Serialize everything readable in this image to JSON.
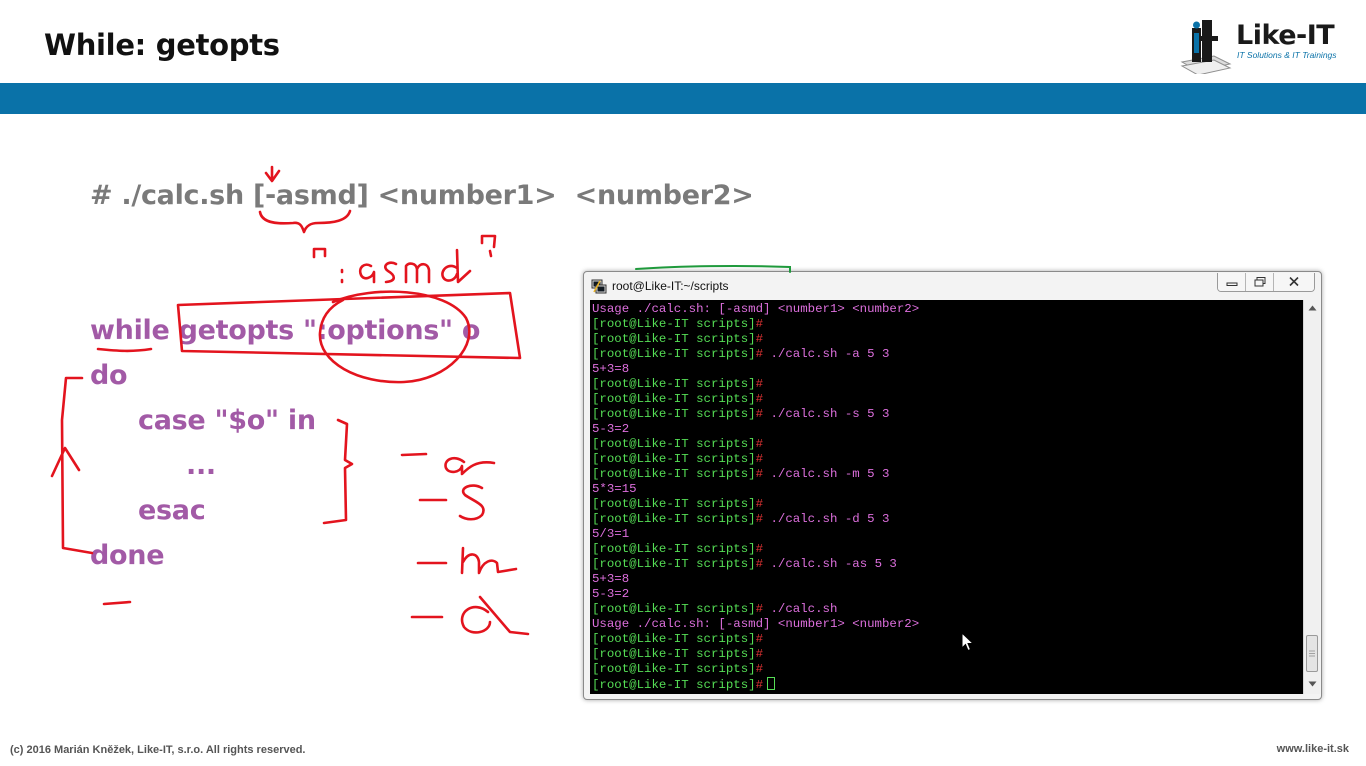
{
  "slide": {
    "title": "While: getopts",
    "logo_name": "Like-IT",
    "logo_tagline": "IT Solutions & IT Trainings",
    "syntax_line": "# ./calc.sh [-asmd] <number1>  <number2>",
    "code": [
      {
        "id": "while",
        "text": "while getopts \":options\" o"
      },
      {
        "id": "do",
        "text": "do"
      },
      {
        "id": "case",
        "text": "case \"$o\" in"
      },
      {
        "id": "dots",
        "text": "..."
      },
      {
        "id": "esac",
        "text": "esac"
      },
      {
        "id": "done",
        "text": "done"
      }
    ],
    "footer_copyright": "(c) 2016 Marián Kněžek, Like-IT, s.r.o. All rights reserved.",
    "footer_url": "www.like-it.sk"
  },
  "colors": {
    "header_band": "#0a72a8",
    "code_purple": "#a25aa6",
    "syntax_gray": "#7a7a7a",
    "ink_red": "#e3141e",
    "ink_green": "#1f9a3c",
    "term_prompt": "#55dd55",
    "term_output": "#dd6fdd",
    "term_hash": "#dd3333"
  },
  "terminal": {
    "title": "root@Like-IT:~/scripts",
    "prompt": "[root@Like-IT scripts]",
    "lines": [
      {
        "kind": "out",
        "text": "Usage ./calc.sh: [-asmd] <number1> <number2>"
      },
      {
        "kind": "prompt",
        "cmd": ""
      },
      {
        "kind": "prompt",
        "cmd": ""
      },
      {
        "kind": "prompt",
        "cmd": "./calc.sh -a 5 3"
      },
      {
        "kind": "out",
        "text": "5+3=8"
      },
      {
        "kind": "prompt",
        "cmd": ""
      },
      {
        "kind": "prompt",
        "cmd": ""
      },
      {
        "kind": "prompt",
        "cmd": "./calc.sh -s 5 3"
      },
      {
        "kind": "out",
        "text": "5-3=2"
      },
      {
        "kind": "prompt",
        "cmd": ""
      },
      {
        "kind": "prompt",
        "cmd": ""
      },
      {
        "kind": "prompt",
        "cmd": "./calc.sh -m 5 3"
      },
      {
        "kind": "out",
        "text": "5*3=15"
      },
      {
        "kind": "prompt",
        "cmd": ""
      },
      {
        "kind": "prompt",
        "cmd": "./calc.sh -d 5 3"
      },
      {
        "kind": "out",
        "text": "5/3=1"
      },
      {
        "kind": "prompt",
        "cmd": ""
      },
      {
        "kind": "prompt",
        "cmd": "./calc.sh -as 5 3"
      },
      {
        "kind": "out",
        "text": "5+3=8"
      },
      {
        "kind": "out",
        "text": "5-3=2"
      },
      {
        "kind": "prompt",
        "cmd": "./calc.sh"
      },
      {
        "kind": "out",
        "text": "Usage ./calc.sh: [-asmd] <number1> <number2>"
      },
      {
        "kind": "prompt",
        "cmd": ""
      },
      {
        "kind": "prompt",
        "cmd": ""
      },
      {
        "kind": "prompt",
        "cmd": ""
      },
      {
        "kind": "prompt",
        "cmd": "",
        "cursor": true
      }
    ]
  },
  "icons": {
    "app": "putty-icon",
    "minimize": "minimize-icon",
    "maximize": "maximize-icon",
    "close": "close-icon",
    "scroll_up": "scroll-up-arrow-icon",
    "scroll_down": "scroll-down-arrow-icon",
    "pointer": "mouse-pointer-icon"
  }
}
